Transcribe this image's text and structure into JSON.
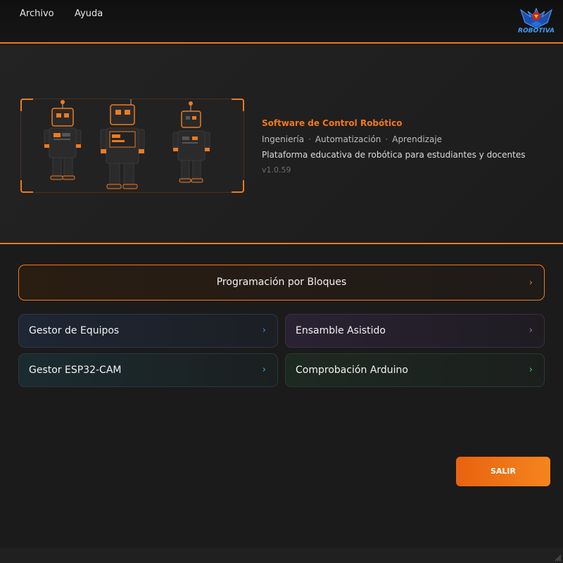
{
  "menu": {
    "items": [
      {
        "label": "Archivo"
      },
      {
        "label": "Ayuda"
      }
    ]
  },
  "logo": {
    "icon": "robotiva-eagle-logo",
    "text": "ROBOTIVA"
  },
  "hero": {
    "title": "Software de Control Robótico",
    "tags": [
      "Ingeniería",
      "Automatización",
      "Aprendizaje"
    ],
    "tag_separator": "·",
    "description": "Plataforma educativa de robótica para estudiantes y docentes",
    "version": "v1.0.59"
  },
  "main": {
    "primary": {
      "label": "Programación por Bloques",
      "chevron": "›"
    },
    "tiles": [
      {
        "label": "Gestor de Equipos",
        "chevron": "›",
        "accent": "#4a8cf0"
      },
      {
        "label": "Ensamble Asistido",
        "chevron": "›",
        "accent": "#b06ad8"
      },
      {
        "label": "Gestor ESP32-CAM",
        "chevron": "›",
        "accent": "#2fb6d6"
      },
      {
        "label": "Comprobación Arduino",
        "chevron": "›",
        "accent": "#3fcf6a"
      }
    ]
  },
  "exit": {
    "label": "SALIR"
  },
  "colors": {
    "accent": "#f07a1e",
    "background": "#1b1b1b"
  }
}
